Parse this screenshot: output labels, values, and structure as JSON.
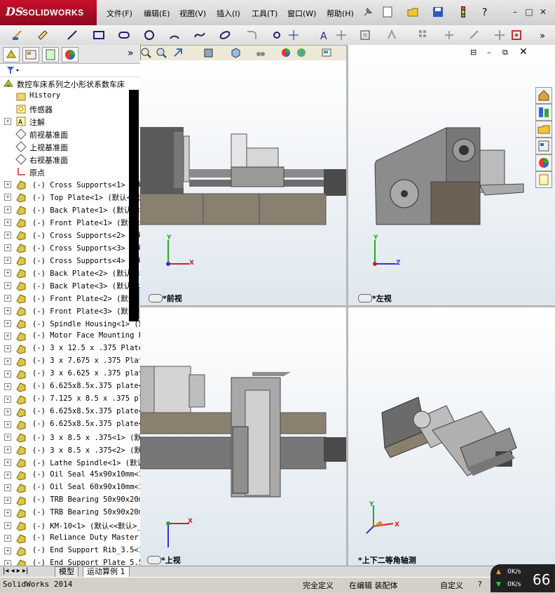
{
  "app": {
    "logo_prefix": "DS",
    "logo_name": "SOLIDWORKS"
  },
  "menu": [
    "文件(F)",
    "编辑(E)",
    "视图(V)",
    "插入(I)",
    "工具(T)",
    "窗口(W)",
    "帮助(H)"
  ],
  "window_controls": [
    "?",
    "–",
    "□",
    "✕"
  ],
  "feature_tree": {
    "root": "数控车床系列之小形状系数车床",
    "top_items": [
      "History",
      "传感器",
      "注解",
      "前视基准面",
      "上视基准面",
      "右视基准面",
      "原点"
    ],
    "parts": [
      "(-) Cross Supports<1> (默认",
      "(-) Top Plate<1> (默认<<默",
      "(-) Back Plate<1> (默认<<默",
      "(-) Front Plate<1> (默认<",
      "(-) Cross Supports<2> (默认",
      "(-) Cross Supports<3> (默认",
      "(-) Cross Supports<4> (默认",
      "(-) Back Plate<2> (默认<<默",
      "(-) Back Plate<3> (默认<<默",
      "(-) Front Plate<2> (默认<<",
      "(-) Front Plate<3> (默认<<",
      "(-) Spindle Housing<1> (默认",
      "(-) Motor Face Mounting Pl",
      "(-) 3 x 12.5 x .375 Plate<",
      "(-) 3 x 7.675 x .375 Plate",
      "(-) 3 x 6.625 x .375 plate",
      "(-) 6.625x8.5x.375 plate<1",
      "(-) 7.125 x 8.5 x .375 pla",
      "(-) 6.625x8.5x.375 plate<2",
      "(-) 6.625x8.5x.375 plate<3",
      "(-) 3 x 8.5 x .375<1> (默认",
      "(-) 3 x 8.5 x .375<2> (默认",
      "(-) Lathe Spindle<1> (默认<",
      "(-) Oil Seal 45x90x10mm<1>",
      "(-) Oil Seal 60x90x10mm<1>",
      "(-) TRB Bearing 50x90x20mm",
      "(-) TRB Bearing 50x90x20mm",
      "(-) KM-10<1> (默认<<默认>_",
      "(-) Reliance Duty Master 2",
      "(-) End Support Rib_3.5<1>",
      "(-) End Support Plate_5.5"
    ]
  },
  "viewports": {
    "front": {
      "label": "*前视",
      "axes": [
        "Y",
        "X"
      ]
    },
    "left": {
      "label": "*左视",
      "axes": [
        "Y",
        "Z"
      ]
    },
    "top": {
      "label": "*上视",
      "axes": [
        "X"
      ]
    },
    "dimetric": {
      "label": "*上下二等角轴测",
      "axes": [
        "Y",
        "X"
      ]
    }
  },
  "bottom_tabs": [
    "模型",
    "运动算例 1"
  ],
  "status": {
    "app": "SolidWorks 2014",
    "def": "完全定义",
    "mode": "在编辑 装配体",
    "custom": "自定义",
    "help": "?"
  },
  "speed": {
    "up": "0K/s",
    "down": "0K/s",
    "value": "66"
  },
  "colors": {
    "logo": "#c8102e",
    "machine_dark": "#5d5d5d",
    "machine_base": "#8a8070"
  }
}
